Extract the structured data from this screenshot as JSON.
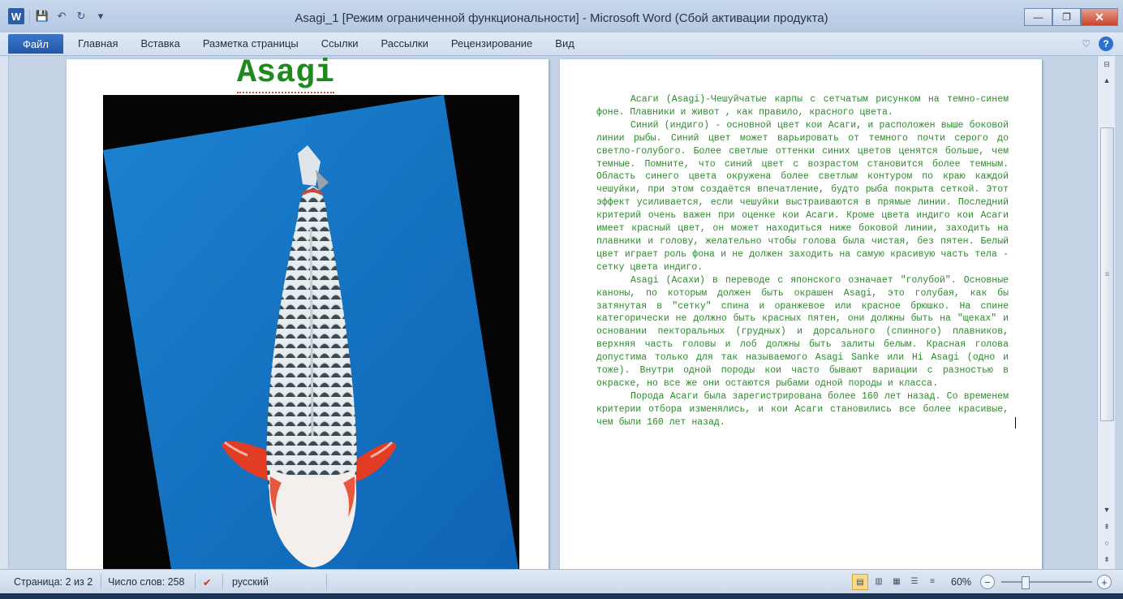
{
  "window": {
    "title": "Asagi_1 [Режим ограниченной функциональности] - Microsoft Word (Сбой активации продукта)",
    "logo_letter": "W",
    "controls": {
      "minimize": "—",
      "maximize": "❐",
      "close": "✕"
    }
  },
  "quick_access": {
    "icons": [
      "save-icon",
      "undo-icon",
      "redo-icon",
      "customize-icon"
    ],
    "save": "💾",
    "undo": "↶",
    "redo": "↻",
    "customize": "▾"
  },
  "ribbon": {
    "file_tab": "Файл",
    "tabs": [
      "Главная",
      "Вставка",
      "Разметка страницы",
      "Ссылки",
      "Рассылки",
      "Рецензирование",
      "Вид"
    ],
    "collapse": "♡",
    "help": "?"
  },
  "document": {
    "heading": "Asagi",
    "paragraphs": [
      "Асаги (Asagi)-Чешуйчатые карпы с сетчатым рисунком на темно-синем фоне. Плавники и живот , как правило, красного цвета.",
      "Синий (индиго) - основной цвет кои Асаги, и расположен выше боковой линии рыбы. Синий цвет может варьировать от темного почти серого до светло-голубого. Более светлые оттенки синих цветов ценятся больше, чем темные. Помните, что синий цвет с возрастом становится более темным. Область синего цвета окружена более светлым контуром по краю каждой чешуйки, при этом создаётся впечатление, будто рыба покрыта сеткой. Этот эффект усиливается, если чешуйки выстраиваются в прямые линии. Последний критерий очень важен при оценке кои Асаги. Кроме цвета индиго кои Асаги имеет красный цвет, он может находиться ниже боковой линии, заходить на плавники и голову, желательно чтобы голова была чистая, без пятен. Белый цвет играет роль фона и не должен заходить на самую красивую часть тела - сетку цвета индиго.",
      "Asagi (Асахи) в переводе с японского означает \"голубой\". Основные каноны, по которым должен быть окрашен Asagi, это голубая, как бы затянутая в \"сетку\" спина и оранжевое или красное брюшко. На спине категорически не должно быть красных пятен, они должны быть на \"щеках\" и основании пекторальных (грудных) и дорсального (спинного) плавников, верхняя часть головы и лоб должны быть залиты белым. Красная голова допустима только для так называемого Asagi Sanke или Hi Asagi (одно и тоже). Внутри одной породы кои часто бывают вариации с разностью в окраске, но все же они остаются рыбами одной породы и класса.",
      "Порода Асаги была зарегистрирована более 160 лет назад. Со временем критерии отбора изменялись, и кои Асаги становились все более красивые, чем были 160 лет назад."
    ],
    "text_color": "#2b8a2b",
    "heading_color": "#1e8a1e"
  },
  "scrollbar": {
    "up": "▲",
    "down": "▼",
    "prev_page": "⇞",
    "next_page": "⇟",
    "browse": "○",
    "grip": "≡"
  },
  "status": {
    "page": "Страница: 2 из 2",
    "words": "Число слов: 258",
    "language": "русский",
    "zoom": "60%",
    "zoom_level": 0.6,
    "zoom_out": "−",
    "zoom_in": "+",
    "view_icons": [
      "print-layout-icon",
      "full-screen-reading-icon",
      "web-layout-icon",
      "outline-icon",
      "draft-icon"
    ]
  }
}
